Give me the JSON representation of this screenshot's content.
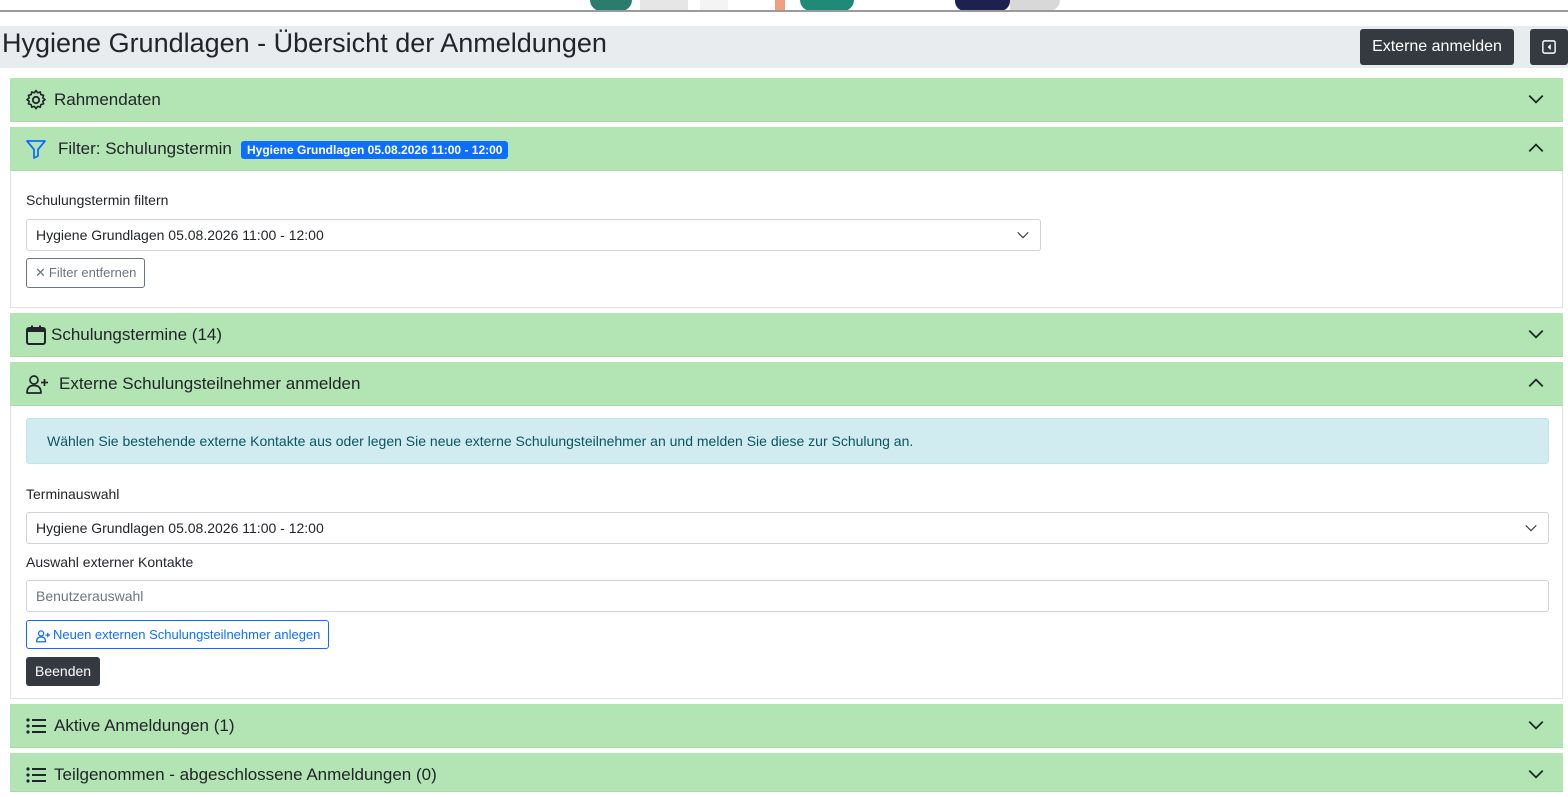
{
  "header": {
    "title": "Hygiene Grundlagen - Übersicht der Anmeldungen",
    "externe_button": "Externe anmelden",
    "collapse_icon": "sidebar-collapse-icon"
  },
  "accent_colors": {
    "panel_header": "#b3e5b4",
    "badge": "#0d6efd",
    "info": "#d1ecf1",
    "dark_button": "#343a40"
  },
  "panels": {
    "rahmendaten": {
      "title": "Rahmendaten",
      "icon": "gear-icon",
      "state": "collapsed"
    },
    "filter": {
      "title": "Filter: Schulungstermin",
      "icon": "filter-icon",
      "state": "expanded",
      "badge": "Hygiene Grundlagen 05.08.2026 11:00 - 12:00",
      "select_label": "Schulungstermin filtern",
      "select_value": "Hygiene Grundlagen 05.08.2026 11:00 - 12:00",
      "remove_button": "Filter entfernen"
    },
    "schulungstermine": {
      "title": "Schulungstermine (14)",
      "icon": "calendar-icon",
      "state": "collapsed"
    },
    "externe": {
      "title": "Externe Schulungsteilnehmer anmelden",
      "icon": "user-plus-icon",
      "state": "expanded",
      "info": "Wählen Sie bestehende externe Kontakte aus oder legen Sie neue externe Schulungsteilnehmer an und melden Sie diese zur Schulung an.",
      "termin_label": "Terminauswahl",
      "termin_value": "Hygiene Grundlagen 05.08.2026 11:00 - 12:00",
      "kontakte_label": "Auswahl externer Kontakte",
      "kontakte_placeholder": "Benutzerauswahl",
      "new_button": "Neuen externen Schulungsteilnehmer anlegen",
      "finish_button": "Beenden"
    },
    "aktive": {
      "title": "Aktive Anmeldungen (1)",
      "icon": "list-icon",
      "state": "collapsed"
    },
    "teilgenommen": {
      "title": "Teilgenommen - abgeschlossene Anmeldungen (0)",
      "icon": "list-icon",
      "state": "collapsed"
    }
  }
}
